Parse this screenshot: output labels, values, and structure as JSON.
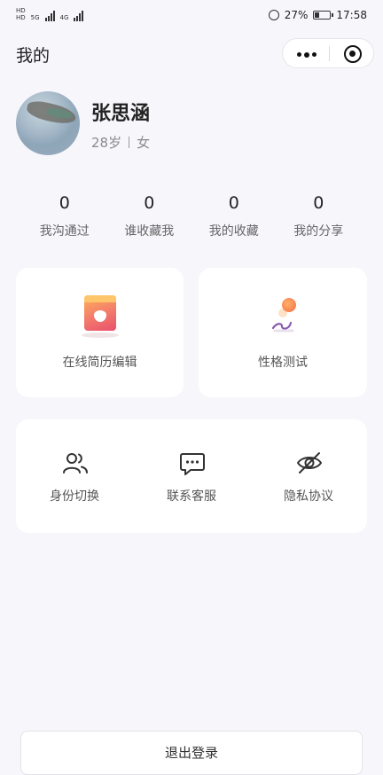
{
  "status_bar": {
    "network_labels": [
      "HD",
      "HD",
      "5G",
      "4G"
    ],
    "battery": "27%",
    "time": "17:58"
  },
  "nav": {
    "title": "我的"
  },
  "profile": {
    "name": "张思涵",
    "age": "28岁",
    "gender": "女"
  },
  "stats": [
    {
      "value": "0",
      "label": "我沟通过"
    },
    {
      "value": "0",
      "label": "谁收藏我"
    },
    {
      "value": "0",
      "label": "我的收藏"
    },
    {
      "value": "0",
      "label": "我的分享"
    }
  ],
  "cards": {
    "resume": {
      "label": "在线简历编辑",
      "icon": "resume-icon"
    },
    "personality": {
      "label": "性格测试",
      "icon": "personality-test-icon"
    }
  },
  "services": [
    {
      "label": "身份切换",
      "icon": "users-icon"
    },
    {
      "label": "联系客服",
      "icon": "chat-icon"
    },
    {
      "label": "隐私协议",
      "icon": "eye-off-icon"
    }
  ],
  "logout_label": "退出登录"
}
